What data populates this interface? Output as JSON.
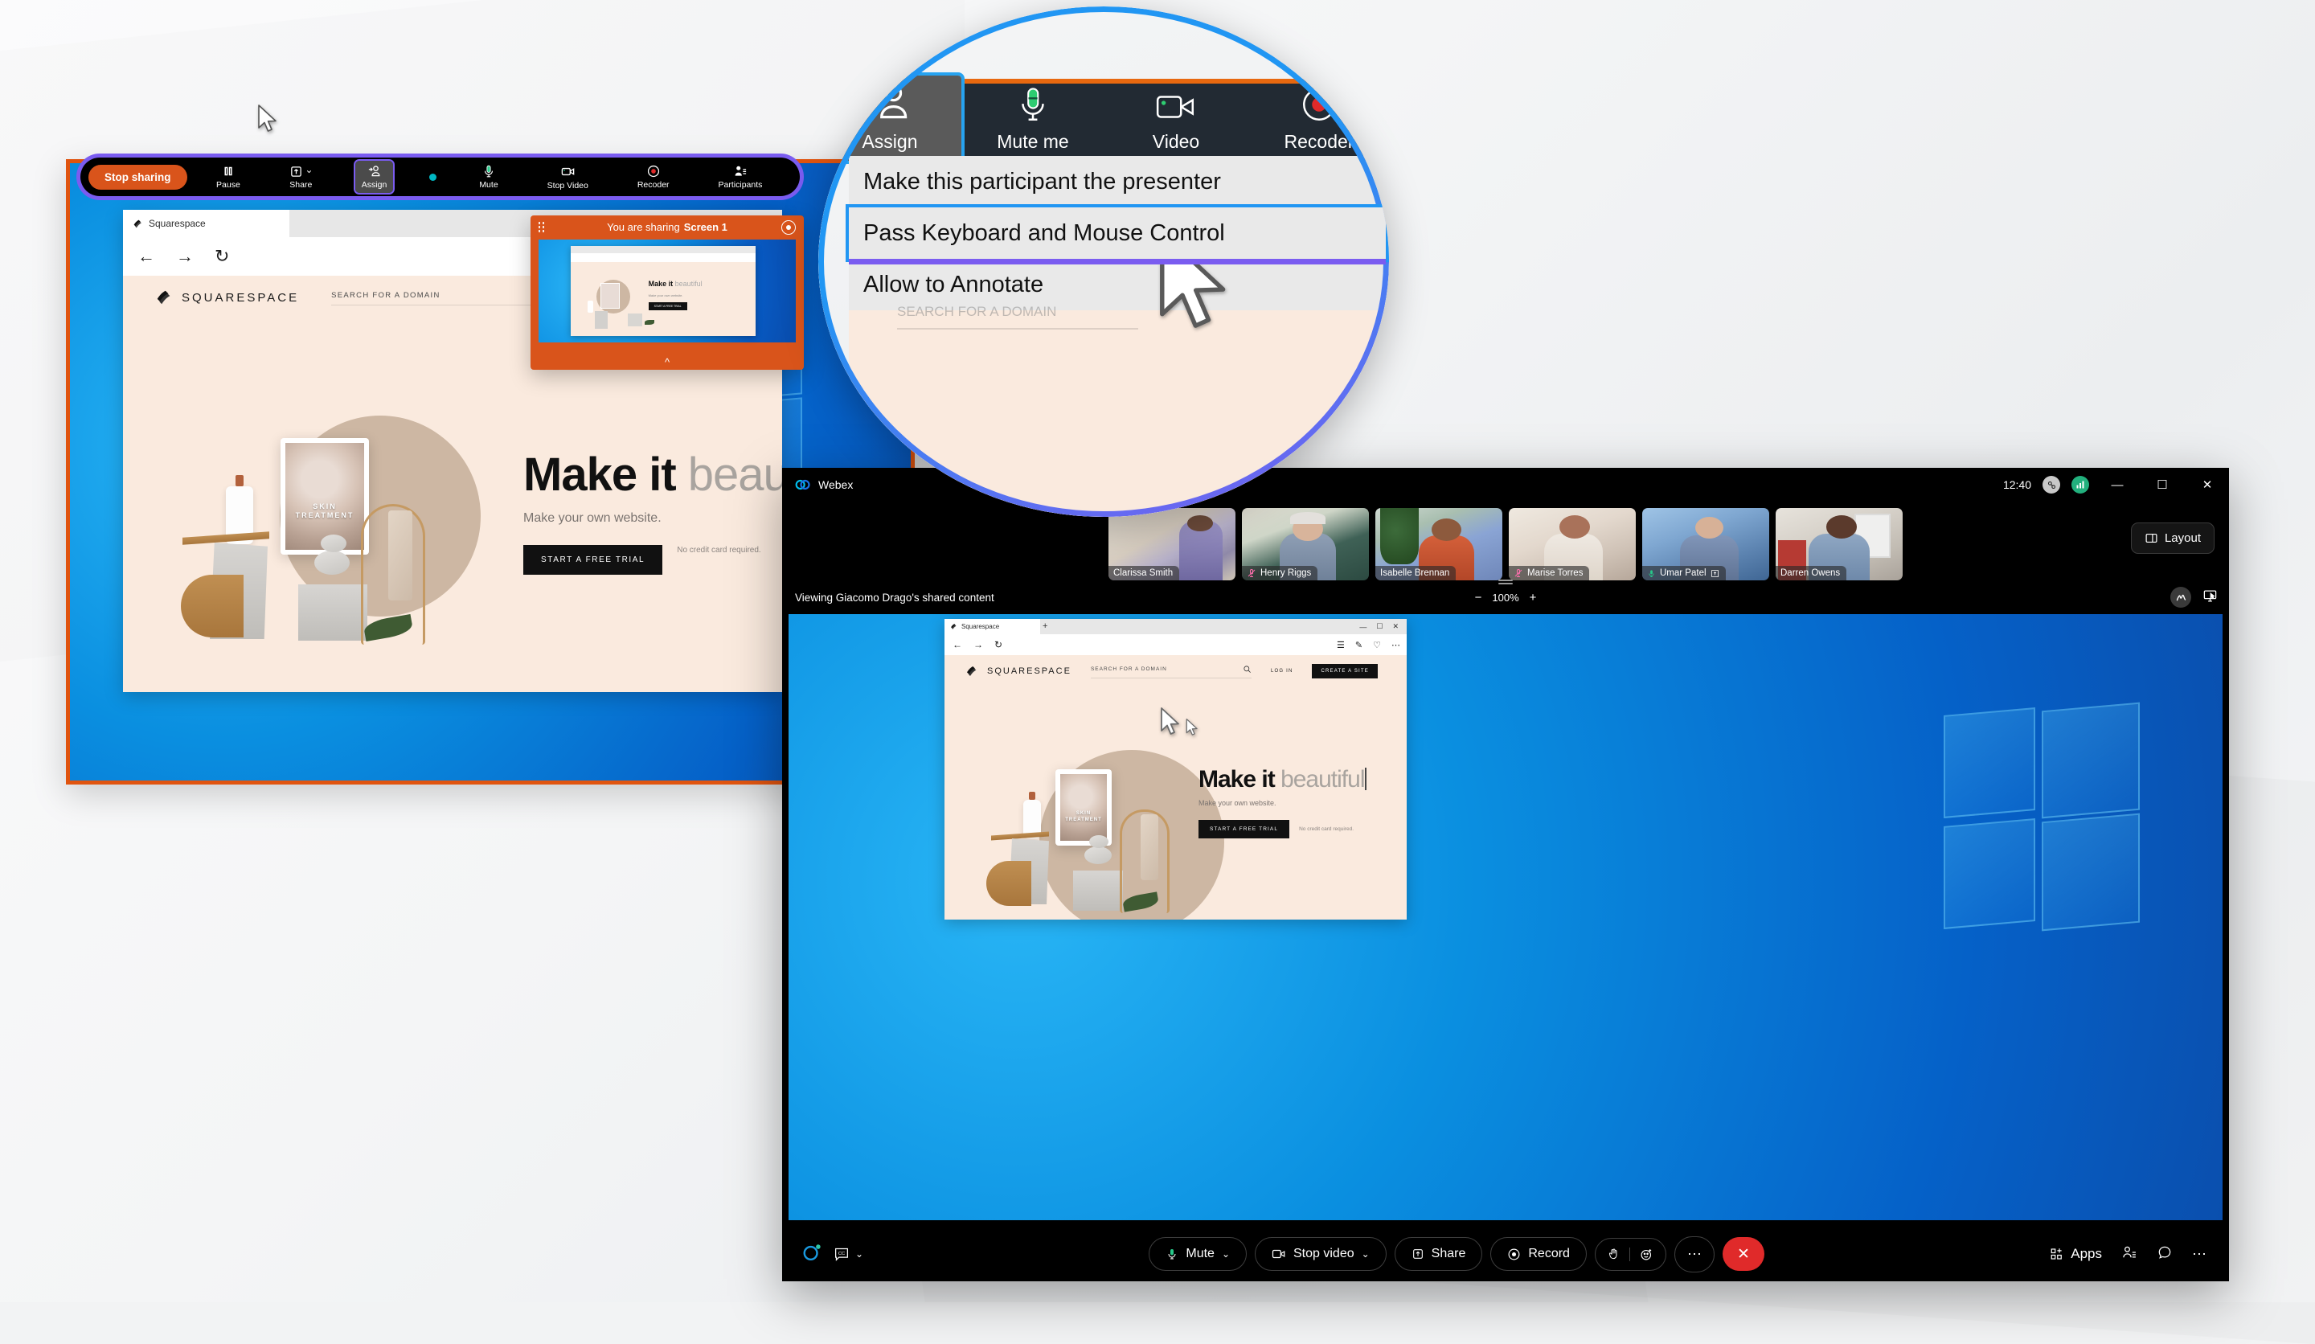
{
  "share_bar": {
    "stop_sharing_label": "Stop sharing",
    "items": [
      {
        "label": "Pause",
        "icon": "pause-icon"
      },
      {
        "label": "Share",
        "icon": "share-screen-icon"
      },
      {
        "label": "Assign",
        "icon": "assign-participant-icon"
      },
      {
        "label": "Mute",
        "icon": "microphone-icon"
      },
      {
        "label": "Stop Video",
        "icon": "camera-icon"
      },
      {
        "label": "Recoder",
        "icon": "record-icon"
      },
      {
        "label": "Participants",
        "icon": "participants-icon"
      }
    ]
  },
  "sharing_pill": {
    "prefix": "You are sharing",
    "screen": "Screen 1",
    "collapse_icon": "chevron-up-icon",
    "record_icon": "record-icon",
    "grip_icon": "drag-handle-icon"
  },
  "magnifier": {
    "toolbar": [
      {
        "label": "Assign",
        "icon": "assign-participant-icon",
        "active": true
      },
      {
        "label": "Mute me",
        "icon": "microphone-icon"
      },
      {
        "label": "Video",
        "icon": "camera-icon"
      },
      {
        "label": "Recoder",
        "icon": "record-icon"
      }
    ],
    "menu": [
      {
        "label": "Make this participant the presenter",
        "selected": false
      },
      {
        "label": "Pass Keyboard and Mouse Control",
        "selected": true
      },
      {
        "label": "Allow to Annotate",
        "selected": false
      }
    ],
    "cursor_icon": "mouse-pointer-icon"
  },
  "webex": {
    "app_name": "Webex",
    "logo_icon": "webex-logo-icon",
    "time": "12:40",
    "connection_icon": "connection-icon",
    "network_icon": "network-strength-icon",
    "window_controls": {
      "minimize": "—",
      "maximize": "☐",
      "close": "✕"
    },
    "layout_button": {
      "label": "Layout",
      "icon": "layout-grid-icon"
    },
    "participants": [
      {
        "name": "Clarissa Smith",
        "mic": "none"
      },
      {
        "name": "Henry Riggs",
        "mic": "muted"
      },
      {
        "name": "Isabelle Brennan",
        "mic": "none"
      },
      {
        "name": "Marise Torres",
        "mic": "muted"
      },
      {
        "name": "Umar Patel",
        "mic": "active",
        "badge": "presenter-icon"
      },
      {
        "name": "Darren Owens",
        "mic": "none"
      }
    ],
    "viewing_bar": {
      "text": "Viewing Giacomo Drago's shared content",
      "zoom_out": "−",
      "zoom_level": "100%",
      "zoom_in": "+",
      "annotate_icon": "annotate-pen-icon",
      "remote_control_icon": "remote-control-icon"
    },
    "toolbar": {
      "left": [
        {
          "icon": "webex-assistant-icon",
          "label": ""
        },
        {
          "icon": "closed-captions-icon",
          "label": "CC",
          "caret": "˅"
        }
      ],
      "center": [
        {
          "label": "Mute",
          "icon": "microphone-icon",
          "caret": "˅"
        },
        {
          "label": "Stop video",
          "icon": "camera-icon",
          "caret": "˅"
        },
        {
          "label": "Share",
          "icon": "share-screen-icon"
        },
        {
          "label": "Record",
          "icon": "record-icon"
        },
        {
          "label": "",
          "icon": "reactions-icon"
        },
        {
          "label": "",
          "icon": "more-options-icon"
        },
        {
          "label": "",
          "icon": "end-call-icon"
        }
      ],
      "right": [
        {
          "label": "Apps",
          "icon": "apps-grid-icon"
        },
        {
          "label": "",
          "icon": "participants-icon"
        },
        {
          "label": "",
          "icon": "chat-bubble-icon"
        },
        {
          "label": "",
          "icon": "more-options-icon"
        }
      ]
    }
  },
  "browser": {
    "tab_title": "Squarespace",
    "favicon": "squarespace-favicon",
    "new_tab": "+",
    "back_icon": "arrow-left-icon",
    "forward_icon": "arrow-right-icon",
    "reload_icon": "reload-icon",
    "window_controls": {
      "minimize": "—",
      "maximize": "☐",
      "close": "✕"
    },
    "toolbar_icons": [
      "reading-list-icon",
      "notes-icon",
      "favorites-icon",
      "more-options-icon"
    ]
  },
  "squarespace": {
    "brand": "SQUARESPACE",
    "brand_icon": "squarespace-logo-icon",
    "search_placeholder": "SEARCH FOR A DOMAIN",
    "search_icon": "search-icon",
    "login_label": "LOG IN",
    "cta_label": "CREATE A SITE",
    "hero_title_strong": "Make it",
    "hero_title_light": "beautiful",
    "hero_subtitle": "Make your own website.",
    "hero_button": "START A FREE TRIAL",
    "hero_note": "No credit card required.",
    "tablet_caption": "SKIN\nTREATMENT"
  },
  "colors": {
    "webex_orange": "#d9541b",
    "accent_purple": "#7a5cf0",
    "accent_blue": "#2196f3",
    "end_call_red": "#e02a2a",
    "mic_green": "#27c98a",
    "desktop_blue": "#0a8fe0"
  }
}
